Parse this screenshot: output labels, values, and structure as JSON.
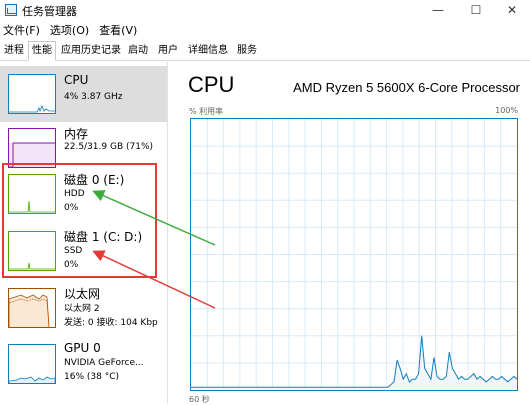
{
  "window": {
    "title": "任务管理器",
    "minimize_glyph": "—",
    "maximize_glyph": "☐",
    "close_glyph": "✕"
  },
  "menu": [
    "文件(F)",
    "选项(O)",
    "查看(V)"
  ],
  "tabs": [
    {
      "label": "进程",
      "active": false
    },
    {
      "label": "性能",
      "active": true
    },
    {
      "label": "应用历史记录",
      "active": false
    },
    {
      "label": "启动",
      "active": false
    },
    {
      "label": "用户",
      "active": false
    },
    {
      "label": "详细信息",
      "active": false
    },
    {
      "label": "服务",
      "active": false
    }
  ],
  "sidebar": {
    "items": [
      {
        "id": "cpu",
        "title": "CPU",
        "sub1": "4% 3.87 GHz",
        "sub2": "",
        "color": "#117dbb",
        "selected": true
      },
      {
        "id": "memory",
        "title": "内存",
        "sub1": "22.5/31.9 GB (71%)",
        "sub2": "",
        "color": "#8b12ae",
        "selected": false
      },
      {
        "id": "disk0",
        "title": "磁盘 0 (E:)",
        "sub1": "HDD",
        "sub2": "0%",
        "color": "#4da60c",
        "selected": false
      },
      {
        "id": "disk1",
        "title": "磁盘 1 (C: D:)",
        "sub1": "SSD",
        "sub2": "0%",
        "color": "#4da60c",
        "selected": false
      },
      {
        "id": "ethernet",
        "title": "以太网",
        "sub1": "以太网 2",
        "sub2": "发送: 0 接收: 104 Kbp",
        "color": "#a74f01",
        "selected": false
      },
      {
        "id": "gpu",
        "title": "GPU 0",
        "sub1": "NVIDIA GeForce...",
        "sub2": "16% (38 °C)",
        "color": "#117dbb",
        "selected": false
      }
    ]
  },
  "main": {
    "title": "CPU",
    "processor": "AMD Ryzen 5 5600X 6-Core Processor",
    "y_label": "% 利用率",
    "y_max_label": "100%",
    "x_label": "60 秒",
    "grid_color": "#d9eaf7",
    "line_color": "#117dbb",
    "fill_color": "#f1f6fa",
    "utilization_percent": [
      1,
      1,
      1,
      1,
      1,
      1,
      1,
      1,
      1,
      1,
      1,
      1,
      1,
      1,
      1,
      1,
      1,
      1,
      1,
      1,
      1,
      1,
      1,
      1,
      1,
      1,
      1,
      1,
      1,
      1,
      1,
      1,
      1,
      1,
      1,
      1,
      1,
      1,
      1,
      1,
      1,
      1,
      1,
      1,
      1,
      1,
      1,
      1,
      1,
      1,
      1,
      1,
      1,
      1,
      1,
      1,
      1,
      1,
      1,
      1,
      1,
      1,
      1,
      1,
      1,
      2,
      3,
      11,
      8,
      4,
      6,
      3,
      4,
      4,
      6,
      20,
      8,
      6,
      4,
      12,
      5,
      4,
      4,
      5,
      14,
      8,
      6,
      4,
      5,
      4,
      4,
      5,
      6,
      4,
      5,
      4,
      3,
      4,
      5,
      4,
      4,
      5,
      4,
      3,
      4,
      5,
      4
    ]
  },
  "annotation_colors": {
    "box": "#e53935",
    "green_arrow": "#3cab3c",
    "red_arrow": "#e53935"
  }
}
